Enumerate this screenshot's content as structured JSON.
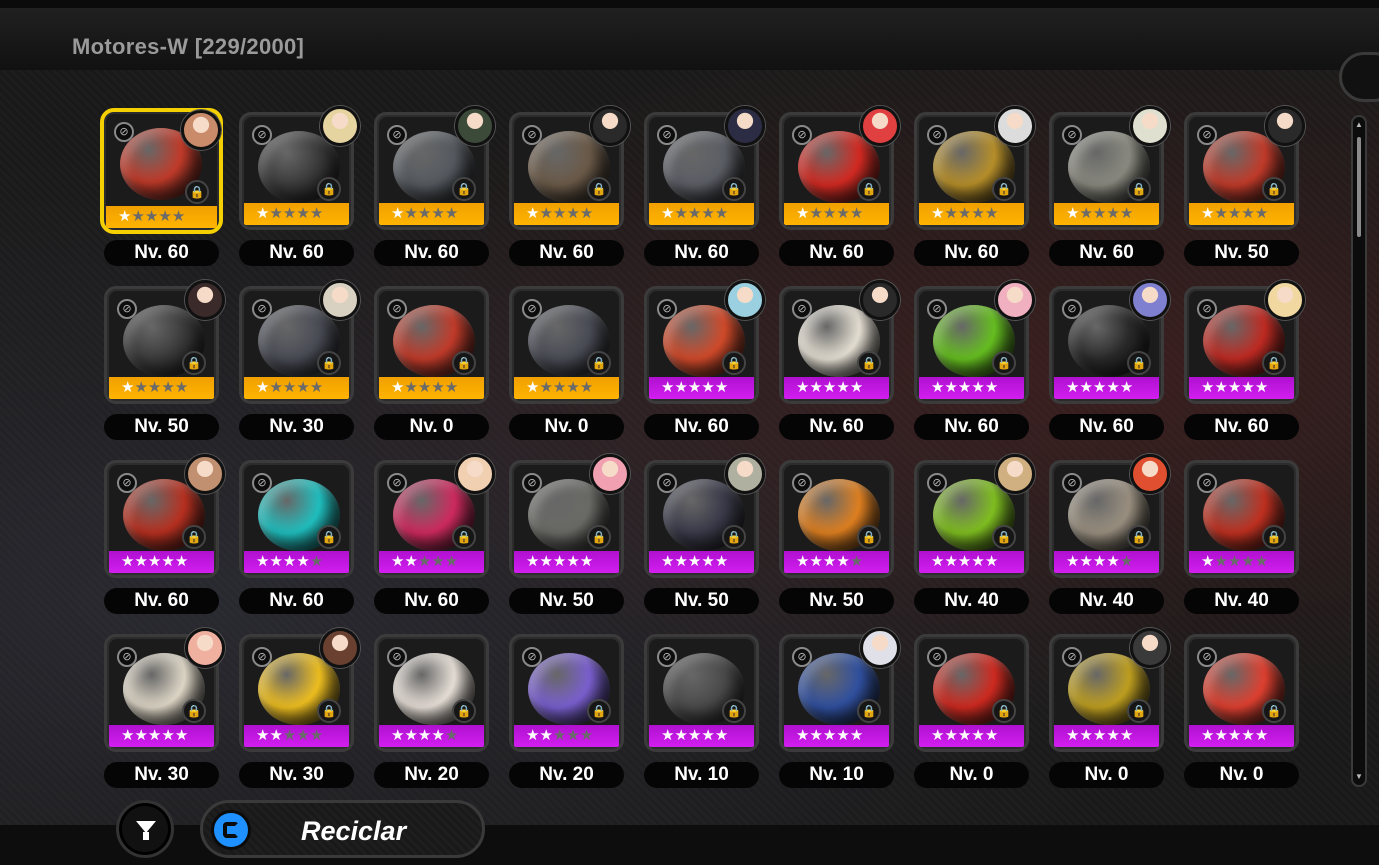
{
  "header": {
    "title": "Motores-W [229/2000]"
  },
  "toolbar": {
    "recycle_label": "Reciclar"
  },
  "colors": {
    "selection": "#f5d000",
    "rank_a": "#ffb400",
    "rank_s": "#d21ef0",
    "recycle_icon": "#1e90ff"
  },
  "engines": [
    {
      "level": "Nv. 60",
      "rank": "a",
      "stars": 1,
      "selected": true,
      "color": "#c23b2a",
      "avatar": "#c98b6a",
      "type": "⊘"
    },
    {
      "level": "Nv. 60",
      "rank": "a",
      "stars": 1,
      "color": "#3a3a3a",
      "avatar": "#e6d4a0",
      "type": "⊘"
    },
    {
      "level": "Nv. 60",
      "rank": "a",
      "stars": 1,
      "color": "#555a60",
      "avatar": "#3c4a3a",
      "type": "⊘"
    },
    {
      "level": "Nv. 60",
      "rank": "a",
      "stars": 1,
      "color": "#6b5a48",
      "avatar": "#2a2a2a",
      "type": "⊘"
    },
    {
      "level": "Nv. 60",
      "rank": "a",
      "stars": 1,
      "color": "#5c5e66",
      "avatar": "#2c2c44",
      "type": "⊘"
    },
    {
      "level": "Nv. 60",
      "rank": "a",
      "stars": 1,
      "color": "#d42a22",
      "avatar": "#e04040",
      "type": "⊘"
    },
    {
      "level": "Nv. 60",
      "rank": "a",
      "stars": 1,
      "color": "#b8902a",
      "avatar": "#dcdcdc",
      "type": "⊘"
    },
    {
      "level": "Nv. 60",
      "rank": "a",
      "stars": 1,
      "color": "#8a8a80",
      "avatar": "#e0e0d0",
      "type": "⊘"
    },
    {
      "level": "Nv. 50",
      "rank": "a",
      "stars": 1,
      "color": "#c23b2a",
      "avatar": "#2a2a2a",
      "type": "⊘"
    },
    {
      "level": "Nv. 50",
      "rank": "a",
      "stars": 1,
      "color": "#3a3a3a",
      "avatar": "#3a2a2a",
      "type": "⊘"
    },
    {
      "level": "Nv. 30",
      "rank": "a",
      "stars": 1,
      "color": "#4a4c56",
      "avatar": "#d8d0c0",
      "type": "⊘"
    },
    {
      "level": "Nv. 0",
      "rank": "a",
      "stars": 1,
      "color": "#c23b2a",
      "avatar": null,
      "type": "⊘"
    },
    {
      "level": "Nv. 0",
      "rank": "a",
      "stars": 1,
      "color": "#4a4c56",
      "avatar": null,
      "type": "⊘"
    },
    {
      "level": "Nv. 60",
      "rank": "s",
      "stars": 5,
      "color": "#d24a2a",
      "avatar": "#9ad0e0",
      "type": "⊘"
    },
    {
      "level": "Nv. 60",
      "rank": "s",
      "stars": 5,
      "color": "#e6e0d4",
      "avatar": "#2a2a2a",
      "type": "⊘"
    },
    {
      "level": "Nv. 60",
      "rank": "s",
      "stars": 5,
      "color": "#66c020",
      "avatar": "#f0b0c0",
      "type": "⊘"
    },
    {
      "level": "Nv. 60",
      "rank": "s",
      "stars": 5,
      "color": "#2a2a2a",
      "avatar": "#8080d0",
      "type": "⊘"
    },
    {
      "level": "Nv. 60",
      "rank": "s",
      "stars": 5,
      "color": "#c02a22",
      "avatar": "#f0d8a0",
      "type": "⊘"
    },
    {
      "level": "Nv. 60",
      "rank": "s",
      "stars": 5,
      "color": "#b83020",
      "avatar": "#c09070",
      "type": "⊘"
    },
    {
      "level": "Nv. 60",
      "rank": "s",
      "stars": 4,
      "color": "#20c0c0",
      "avatar": null,
      "type": "⊘"
    },
    {
      "level": "Nv. 60",
      "rank": "s",
      "stars": 2,
      "color": "#d02a60",
      "avatar": "#f0d0b0",
      "type": "⊘"
    },
    {
      "level": "Nv. 50",
      "rank": "s",
      "stars": 5,
      "color": "#6a6a66",
      "avatar": "#f0a0b0",
      "type": "⊘"
    },
    {
      "level": "Nv. 50",
      "rank": "s",
      "stars": 5,
      "color": "#3a3a4a",
      "avatar": "#b0b0a0",
      "type": "⊘"
    },
    {
      "level": "Nv. 50",
      "rank": "s",
      "stars": 4,
      "color": "#e08020",
      "avatar": null,
      "type": "⊘"
    },
    {
      "level": "Nv. 40",
      "rank": "s",
      "stars": 5,
      "color": "#80c020",
      "avatar": "#d0b080",
      "type": "⊘"
    },
    {
      "level": "Nv. 40",
      "rank": "s",
      "stars": 4,
      "color": "#9a9080",
      "avatar": "#e05030",
      "type": "⊘"
    },
    {
      "level": "Nv. 40",
      "rank": "s",
      "stars": 1,
      "color": "#c03020",
      "avatar": null,
      "type": "⊘"
    },
    {
      "level": "Nv. 30",
      "rank": "s",
      "stars": 5,
      "color": "#e0d8c8",
      "avatar": "#f0b0a0",
      "type": "⊘"
    },
    {
      "level": "Nv. 30",
      "rank": "s",
      "stars": 2,
      "color": "#f0c020",
      "avatar": "#6a4030",
      "type": "⊘"
    },
    {
      "level": "Nv. 20",
      "rank": "s",
      "stars": 4,
      "color": "#e8e0d8",
      "avatar": null,
      "type": "⊘"
    },
    {
      "level": "Nv. 20",
      "rank": "s",
      "stars": 2,
      "color": "#7a60d0",
      "avatar": null,
      "type": "⊘"
    },
    {
      "level": "Nv. 10",
      "rank": "s",
      "stars": 5,
      "color": "#4a4a4a",
      "avatar": null,
      "type": "⊘"
    },
    {
      "level": "Nv. 10",
      "rank": "s",
      "stars": 5,
      "color": "#3050a0",
      "avatar": "#e0e0e8",
      "type": "⊘"
    },
    {
      "level": "Nv. 0",
      "rank": "s",
      "stars": 5,
      "color": "#d02a20",
      "avatar": null,
      "type": "⊘"
    },
    {
      "level": "Nv. 0",
      "rank": "s",
      "stars": 5,
      "color": "#c0a020",
      "avatar": "#3a3a3a",
      "type": "⊘"
    },
    {
      "level": "Nv. 0",
      "rank": "s",
      "stars": 5,
      "color": "#e04030",
      "avatar": null,
      "type": "⊘"
    }
  ]
}
